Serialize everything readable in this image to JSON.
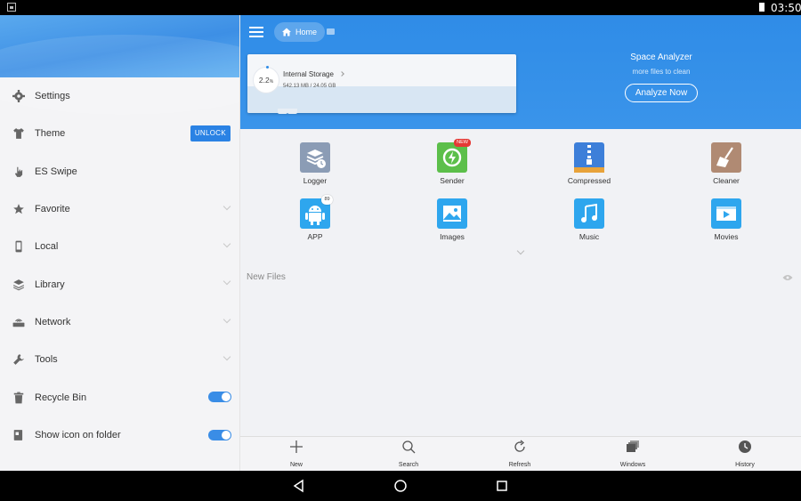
{
  "status_bar": {
    "time": "03:50"
  },
  "drawer": {
    "items": [
      {
        "label": "Settings"
      },
      {
        "label": "Theme",
        "action": "UNLOCK"
      },
      {
        "label": "ES Swipe"
      },
      {
        "label": "Favorite"
      },
      {
        "label": "Local"
      },
      {
        "label": "Library"
      },
      {
        "label": "Network"
      },
      {
        "label": "Tools"
      },
      {
        "label": "Recycle Bin",
        "toggle": true
      },
      {
        "label": "Show icon on folder",
        "toggle": true
      }
    ]
  },
  "header": {
    "breadcrumb": "Home",
    "storage": {
      "title": "Internal Storage",
      "percent": "2.2",
      "percent_unit": "%",
      "size": "542.13 MB / 24.05 GB"
    },
    "analyzer": {
      "title": "Space Analyzer",
      "subtitle": "more files to clean",
      "button": "Analyze Now"
    }
  },
  "categories": [
    {
      "label": "Logger",
      "icon": "logger-icon",
      "color": "#8b9cb5"
    },
    {
      "label": "Sender",
      "icon": "sender-icon",
      "color": "#5cbf4a",
      "badge": "NEW"
    },
    {
      "label": "Compressed",
      "icon": "compressed-icon",
      "color": "#3d7fd9"
    },
    {
      "label": "Cleaner",
      "icon": "cleaner-icon",
      "color": "#b08a73"
    },
    {
      "label": "APP",
      "icon": "app-icon",
      "color": "#2ea6ee",
      "badge": "89"
    },
    {
      "label": "Images",
      "icon": "images-icon",
      "color": "#2ea6ee"
    },
    {
      "label": "Music",
      "icon": "music-icon",
      "color": "#2ea6ee"
    },
    {
      "label": "Movies",
      "icon": "movies-icon",
      "color": "#2ea6ee"
    }
  ],
  "new_files": {
    "label": "New Files"
  },
  "toolbar": {
    "items": [
      {
        "label": "New",
        "icon": "plus-icon"
      },
      {
        "label": "Search",
        "icon": "search-icon"
      },
      {
        "label": "Refresh",
        "icon": "refresh-icon"
      },
      {
        "label": "Windows",
        "icon": "windows-icon"
      },
      {
        "label": "History",
        "icon": "history-icon"
      }
    ]
  },
  "colors": {
    "accent": "#2f8ce7",
    "toggle_on": "#3a8de6",
    "badge_new": "#e53935"
  }
}
